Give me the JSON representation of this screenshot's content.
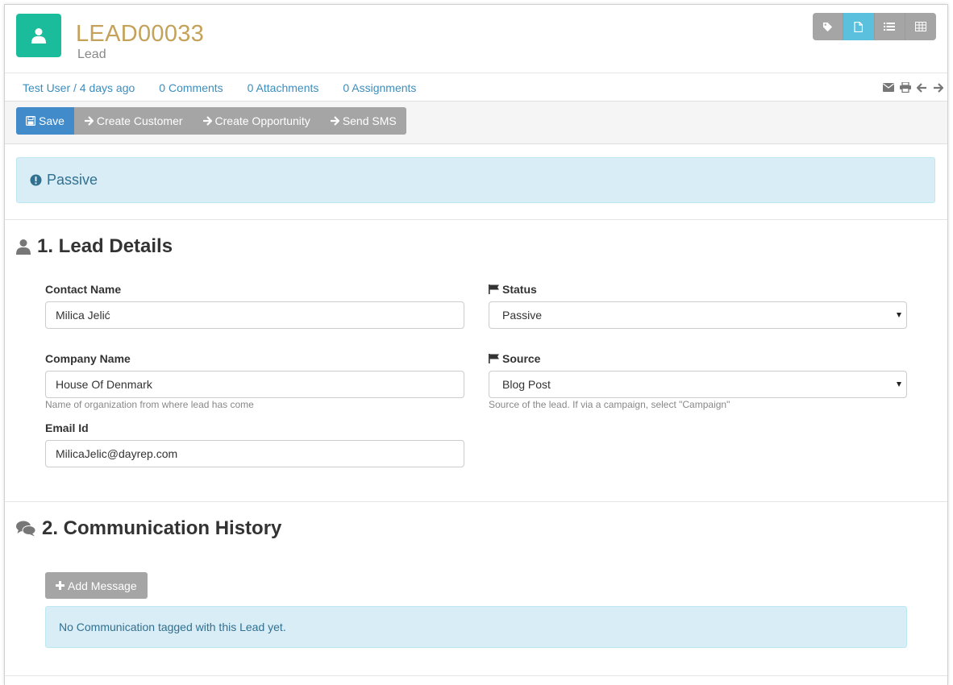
{
  "header": {
    "title": "LEAD00033",
    "subtitle": "Lead",
    "avatar_color": "#1abc9c",
    "view_buttons": [
      "tag-icon",
      "document-icon",
      "list-icon",
      "grid-icon"
    ],
    "active_view": "document-icon"
  },
  "meta": {
    "author_time": "Test User / 4 days ago",
    "comments": "0 Comments",
    "attachments": "0 Attachments",
    "assignments": "0 Assignments",
    "icons": [
      "email-icon",
      "print-icon",
      "arrow-left-icon",
      "arrow-right-icon"
    ]
  },
  "toolbar": {
    "save_label": "Save",
    "create_customer_label": "Create Customer",
    "create_opportunity_label": "Create Opportunity",
    "send_sms_label": "Send SMS"
  },
  "alert": {
    "text": "Passive"
  },
  "section1": {
    "title": "1. Lead Details",
    "contact_name": {
      "label": "Contact Name",
      "value": "Milica Jelić"
    },
    "company_name": {
      "label": "Company Name",
      "value": "House Of Denmark",
      "help": "Name of organization from where lead has come"
    },
    "email": {
      "label": "Email Id",
      "value": "MilicaJelic@dayrep.com"
    },
    "status": {
      "label": "Status",
      "value": "Passive"
    },
    "source": {
      "label": "Source",
      "value": "Blog Post",
      "help": "Source of the lead. If via a campaign, select \"Campaign\""
    }
  },
  "section2": {
    "title": "2. Communication History",
    "add_message_label": "Add Message",
    "empty_text": "No Communication tagged with this Lead yet."
  },
  "colors": {
    "primary": "#428bca",
    "gray_button": "#a5a5a5",
    "title_gold": "#c4a25a",
    "info_bg": "#d9edf7",
    "info_text": "#31708f",
    "link": "#3c8dbc"
  }
}
